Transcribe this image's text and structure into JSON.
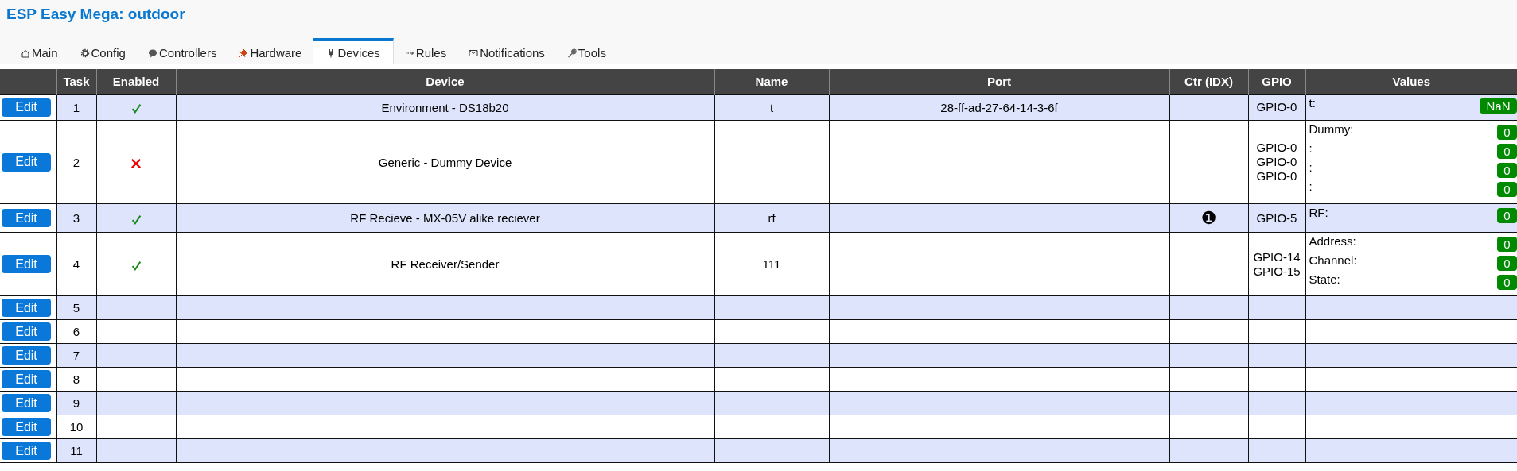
{
  "title": "ESP Easy Mega: outdoor",
  "tabs": [
    {
      "label": "Main",
      "selected": false
    },
    {
      "label": "Config",
      "selected": false
    },
    {
      "label": "Controllers",
      "selected": false
    },
    {
      "label": "Hardware",
      "selected": false
    },
    {
      "label": "Devices",
      "selected": true
    },
    {
      "label": "Rules",
      "selected": false
    },
    {
      "label": "Notifications",
      "selected": false
    },
    {
      "label": "Tools",
      "selected": false
    }
  ],
  "table": {
    "columns": [
      "",
      "Task",
      "Enabled",
      "Device",
      "Name",
      "Port",
      "Ctr (IDX)",
      "GPIO",
      "Values"
    ],
    "rows": [
      {
        "button": "Edit",
        "task": "1",
        "enabled": true,
        "device": "Environment - DS18b20",
        "name": "t",
        "port": "28-ff-ad-27-64-14-3-6f",
        "gpio": [
          "GPIO-0"
        ],
        "values": [
          {
            "label": "t:",
            "value": "NaN"
          }
        ]
      },
      {
        "button": "Edit",
        "task": "2",
        "enabled": false,
        "device": "Generic - Dummy Device",
        "gpio": [
          "GPIO-0",
          "GPIO-0",
          "GPIO-0"
        ],
        "values": [
          {
            "label": "Dummy:",
            "value": "0"
          },
          {
            "label": ":",
            "value": "0"
          },
          {
            "label": ":",
            "value": "0"
          },
          {
            "label": ":",
            "value": "0"
          }
        ]
      },
      {
        "button": "Edit",
        "task": "3",
        "enabled": true,
        "device": "RF Recieve - MX-05V alike reciever",
        "name": "rf",
        "ctr": "❶",
        "gpio": [
          "GPIO-5"
        ],
        "values": [
          {
            "label": "RF:",
            "value": "0"
          }
        ]
      },
      {
        "button": "Edit",
        "task": "4",
        "enabled": true,
        "device": "RF Receiver/Sender",
        "name": "111",
        "gpio": [
          "GPIO-14",
          "GPIO-15"
        ],
        "values": [
          {
            "label": "Address:",
            "value": "0"
          },
          {
            "label": "Channel:",
            "value": "0"
          },
          {
            "label": "State:",
            "value": "0"
          }
        ]
      },
      {
        "button": "Edit",
        "task": "5"
      },
      {
        "button": "Edit",
        "task": "6"
      },
      {
        "button": "Edit",
        "task": "7"
      },
      {
        "button": "Edit",
        "task": "8"
      },
      {
        "button": "Edit",
        "task": "9"
      },
      {
        "button": "Edit",
        "task": "10"
      },
      {
        "button": "Edit",
        "task": "11"
      }
    ]
  }
}
